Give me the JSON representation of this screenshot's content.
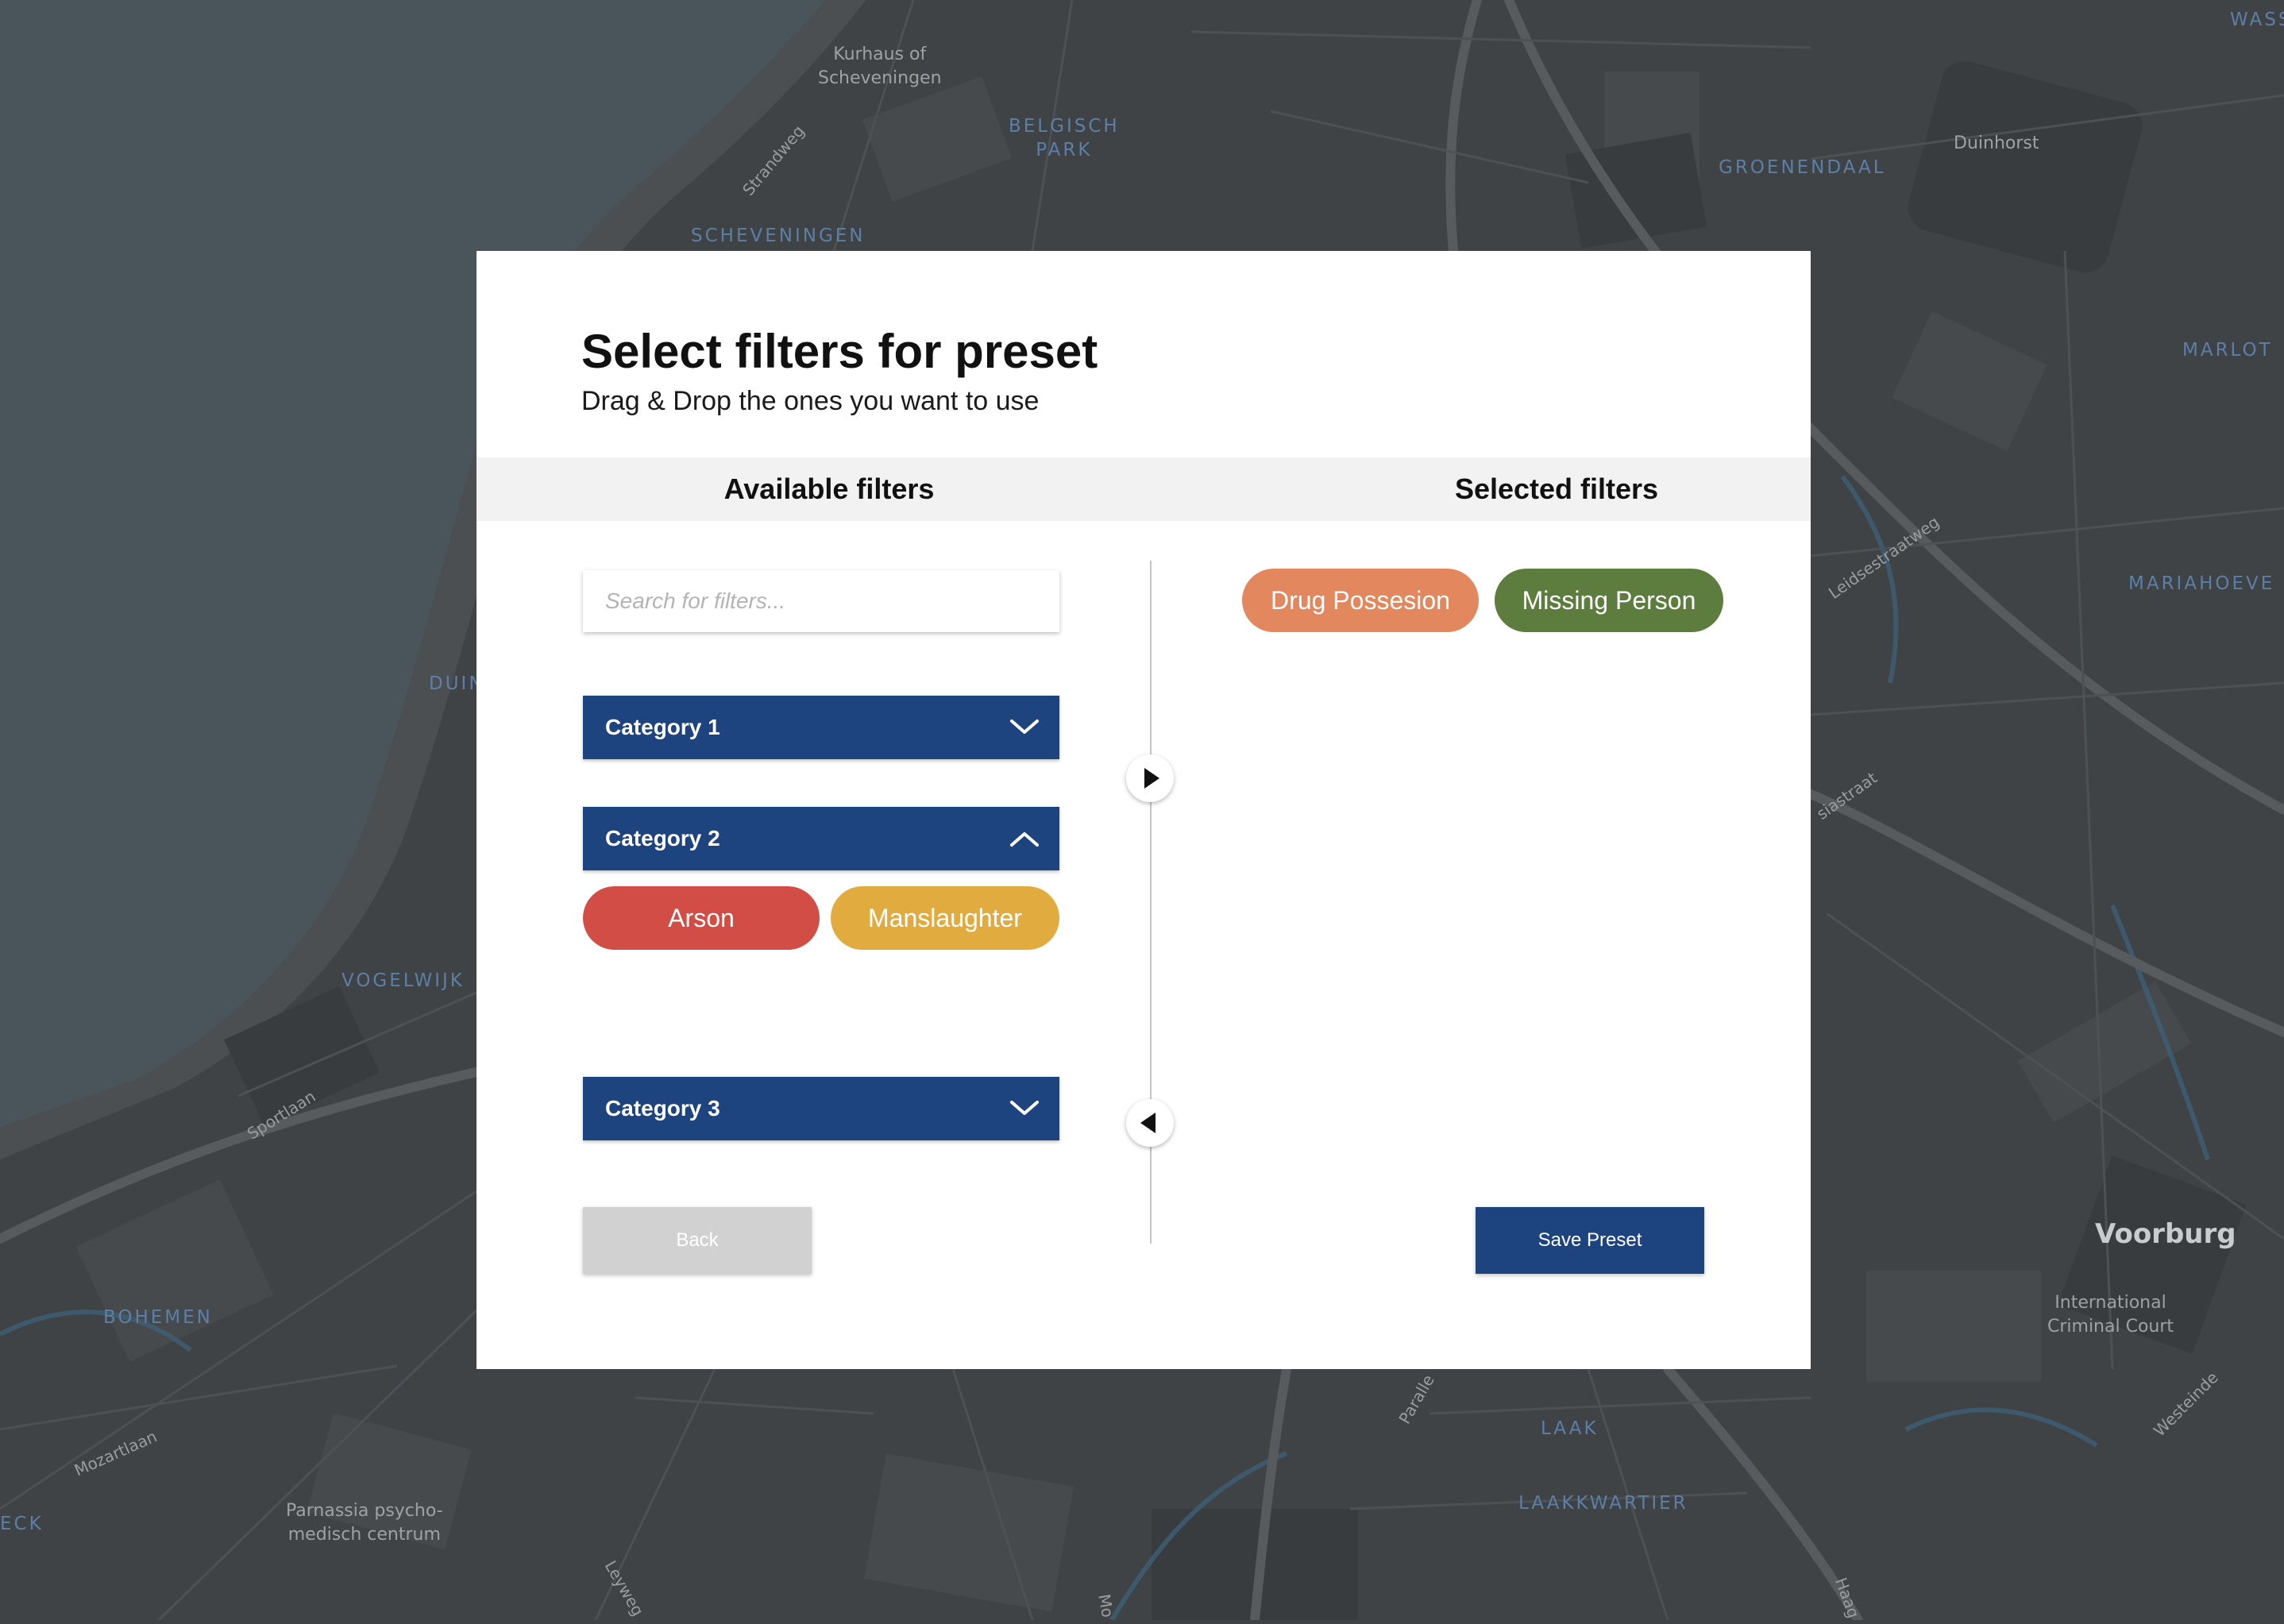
{
  "map": {
    "labels": {
      "kurhaus": "Kurhaus of\nScheveningen",
      "belgisch_park": "BELGISCH\nPARK",
      "strandweg": "Strandweg",
      "scheveningen": "SCHEVENINGEN",
      "groenendaal": "GROENENDAAL",
      "duinhorst": "Duinhorst",
      "wass": "WASS",
      "marlot": "MARLOT",
      "mariahoeve": "MARIAHOEVE",
      "leidsestraatweg": "Leidsestraatweg",
      "duin": "DUIN",
      "siastraat": "siastraat",
      "vogelwijk": "VOGELWIJK",
      "sportlaan": "Sportlaan",
      "bohemen": "BOHEMEN",
      "mozartlaan": "Mozartlaan",
      "eck": "ECK",
      "parnassia": "Parnassia psycho-\nmedisch centrum",
      "leyweg": "Leyweg",
      "voorburg": "Voorburg",
      "icc": "International\nCriminal Court",
      "westeinde": "Westeinde",
      "laak": "LAAK",
      "laakkwartier": "LAAKKWARTIER",
      "parall": "Paralle",
      "haag": "Haag",
      "mo": "Mo"
    }
  },
  "modal": {
    "title": "Select filters for preset",
    "subtitle": "Drag & Drop the ones you want to use",
    "available_title": "Available filters",
    "selected_title": "Selected filters",
    "search_placeholder": "Search for filters...",
    "categories": [
      {
        "label": "Category 1",
        "expanded": false
      },
      {
        "label": "Category 2",
        "expanded": true,
        "chips": [
          {
            "label": "Arson",
            "color": "#d24d45"
          },
          {
            "label": "Manslaughter",
            "color": "#e2ab3f"
          }
        ]
      },
      {
        "label": "Category 3",
        "expanded": false
      }
    ],
    "selected_chips": [
      {
        "label": "Drug Possesion",
        "color": "#e2875e"
      },
      {
        "label": "Missing Person",
        "color": "#5c7d3e"
      }
    ],
    "back_label": "Back",
    "save_label": "Save Preset"
  },
  "colors": {
    "primary": "#1e4480",
    "disabled": "#d1d1d1"
  }
}
